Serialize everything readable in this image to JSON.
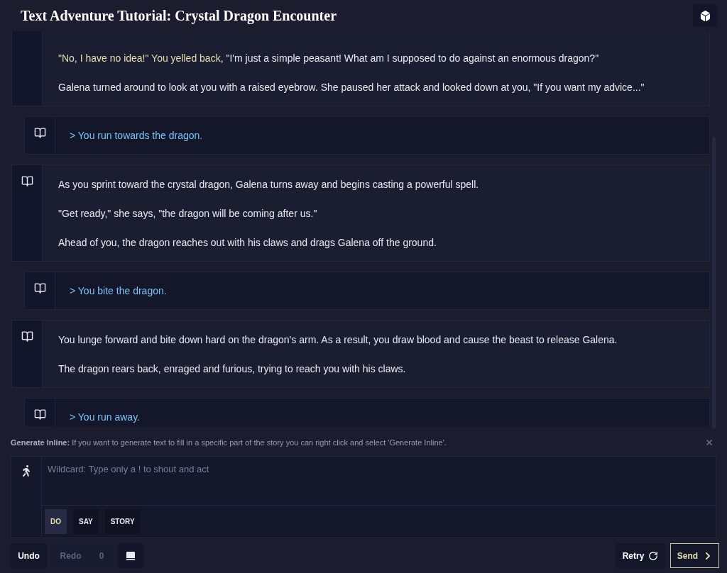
{
  "header": {
    "title": "Text Adventure Tutorial: Crystal Dragon Encounter"
  },
  "story": [
    {
      "kind": "story",
      "cut_top": true,
      "cut_bottom": false,
      "paragraphs": [
        [
          {
            "text": "\"No, I have no idea!\" You yelled back",
            "highlight": true
          },
          {
            "text": ", \"I'm just a simple peasant! What am I supposed to do against an enormous dragon?\"",
            "highlight": false
          }
        ],
        [
          {
            "text": "Galena turned around to look at you with a raised eyebrow. She paused her attack and looked down at you, \"If you want my advice...\"",
            "highlight": false
          }
        ]
      ]
    },
    {
      "kind": "action",
      "cut_top": false,
      "cut_bottom": false,
      "paragraphs": [
        [
          {
            "text": "> You run towards the dragon.",
            "highlight": false
          }
        ]
      ]
    },
    {
      "kind": "story",
      "cut_top": false,
      "cut_bottom": false,
      "paragraphs": [
        [
          {
            "text": "As you sprint toward the crystal dragon, Galena turns away and begins casting a powerful spell.",
            "highlight": false
          }
        ],
        [
          {
            "text": "\"Get ready,\" she says, \"the dragon will be coming after us.\"",
            "highlight": false
          }
        ],
        [
          {
            "text": "Ahead of you, the dragon reaches out with his claws and drags Galena off the ground.",
            "highlight": false
          }
        ]
      ]
    },
    {
      "kind": "action",
      "cut_top": false,
      "cut_bottom": false,
      "paragraphs": [
        [
          {
            "text": "> You bite the dragon.",
            "highlight": false
          }
        ]
      ]
    },
    {
      "kind": "story",
      "cut_top": false,
      "cut_bottom": false,
      "paragraphs": [
        [
          {
            "text": "You lunge forward and bite down hard on the dragon's arm. As a result, you draw blood and cause the beast to release Galena.",
            "highlight": false
          }
        ],
        [
          {
            "text": "The dragon rears back, enraged and furious, trying to reach you with his claws.",
            "highlight": false
          }
        ]
      ]
    },
    {
      "kind": "action",
      "cut_top": false,
      "cut_bottom": true,
      "paragraphs": [
        [
          {
            "text": "> You run away.",
            "highlight": false
          }
        ]
      ]
    }
  ],
  "tip": {
    "text": "**Generate Inline:** If you want to generate text to fill in a specific part of the story you can right click and select 'Generate Inline'."
  },
  "input": {
    "placeholder": "Wildcard: Type only a ! to shout and act",
    "modes": [
      {
        "label": "DO",
        "selected": true
      },
      {
        "label": "SAY",
        "selected": false
      },
      {
        "label": "STORY",
        "selected": false
      }
    ]
  },
  "toolbar": {
    "undo": {
      "label": "Undo",
      "disabled": false
    },
    "redo": {
      "label": "Redo",
      "disabled": true
    },
    "count": "0",
    "retry": {
      "label": "Retry"
    },
    "send": {
      "label": "Send"
    }
  }
}
